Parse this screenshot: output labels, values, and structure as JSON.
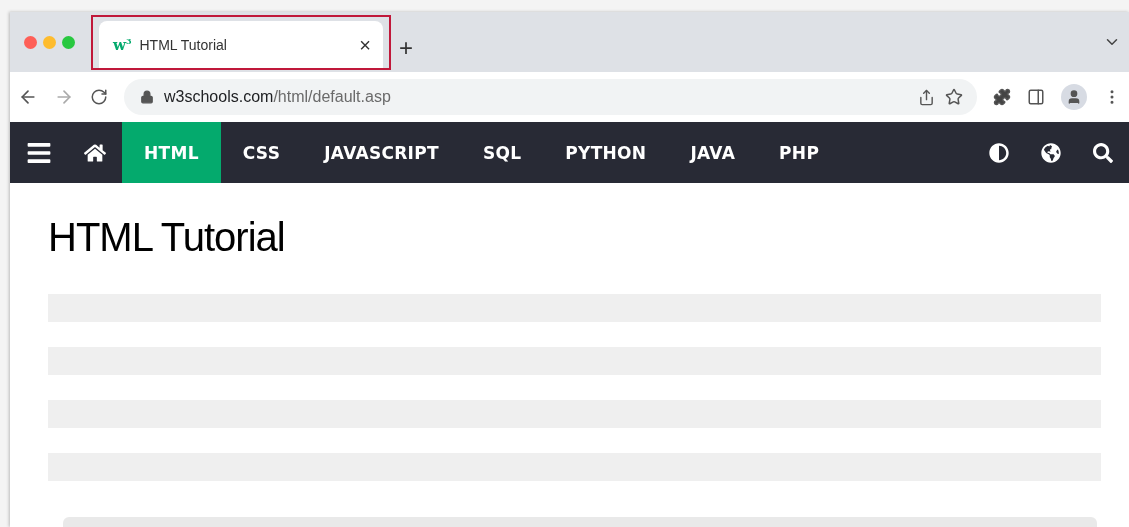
{
  "tab": {
    "logo": "w$^{3}$",
    "title": "HTML Tutorial",
    "close": "×",
    "highlighted": true
  },
  "new_tab": "+",
  "address": {
    "host": "w3schools.com",
    "path": "/html/default.asp"
  },
  "nav": [
    {
      "label": "HTML",
      "selected": true
    },
    {
      "label": "CSS",
      "selected": false
    },
    {
      "label": "JAVASCRIPT",
      "selected": false
    },
    {
      "label": "SQL",
      "selected": false
    },
    {
      "label": "PYTHON",
      "selected": false
    },
    {
      "label": "JAVA",
      "selected": false
    },
    {
      "label": "PHP",
      "selected": false
    }
  ],
  "page": {
    "heading": "HTML Tutorial",
    "placeholder_lines": [
      {
        "kind": "bar"
      },
      {
        "kind": "bar"
      },
      {
        "kind": "bar"
      },
      {
        "kind": "bar"
      }
    ]
  }
}
